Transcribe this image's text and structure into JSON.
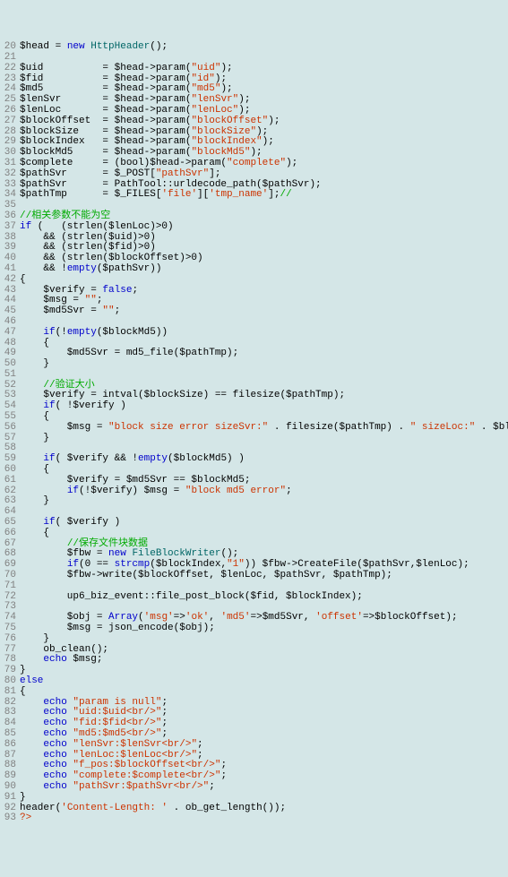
{
  "lines": [
    {
      "n": 20,
      "segs": [
        [
          "",
          "$head = "
        ],
        [
          "kw",
          "new"
        ],
        [
          "",
          " "
        ],
        [
          "cls",
          "HttpHeader"
        ],
        [
          "",
          "();"
        ]
      ]
    },
    {
      "n": 21,
      "segs": [
        [
          "",
          ""
        ]
      ]
    },
    {
      "n": 22,
      "segs": [
        [
          "",
          "$uid          = $head->param("
        ],
        [
          "str",
          "\"uid\""
        ],
        [
          "",
          ");"
        ]
      ]
    },
    {
      "n": 23,
      "segs": [
        [
          "",
          "$fid          = $head->param("
        ],
        [
          "str",
          "\"id\""
        ],
        [
          "",
          ");"
        ]
      ]
    },
    {
      "n": 24,
      "segs": [
        [
          "",
          "$md5          = $head->param("
        ],
        [
          "str",
          "\"md5\""
        ],
        [
          "",
          ");"
        ]
      ]
    },
    {
      "n": 25,
      "segs": [
        [
          "",
          "$lenSvr       = $head->param("
        ],
        [
          "str",
          "\"lenSvr\""
        ],
        [
          "",
          ");"
        ]
      ]
    },
    {
      "n": 26,
      "segs": [
        [
          "",
          "$lenLoc       = $head->param("
        ],
        [
          "str",
          "\"lenLoc\""
        ],
        [
          "",
          ");"
        ]
      ]
    },
    {
      "n": 27,
      "segs": [
        [
          "",
          "$blockOffset  = $head->param("
        ],
        [
          "str",
          "\"blockOffset\""
        ],
        [
          "",
          ");"
        ]
      ]
    },
    {
      "n": 28,
      "segs": [
        [
          "",
          "$blockSize    = $head->param("
        ],
        [
          "str",
          "\"blockSize\""
        ],
        [
          "",
          ");"
        ]
      ]
    },
    {
      "n": 29,
      "segs": [
        [
          "",
          "$blockIndex   = $head->param("
        ],
        [
          "str",
          "\"blockIndex\""
        ],
        [
          "",
          ");"
        ]
      ]
    },
    {
      "n": 30,
      "segs": [
        [
          "",
          "$blockMd5     = $head->param("
        ],
        [
          "str",
          "\"blockMd5\""
        ],
        [
          "",
          ");"
        ]
      ]
    },
    {
      "n": 31,
      "segs": [
        [
          "",
          "$complete     = (bool)$head->param("
        ],
        [
          "str",
          "\"complete\""
        ],
        [
          "",
          ");"
        ]
      ]
    },
    {
      "n": 32,
      "segs": [
        [
          "",
          "$pathSvr      = $_POST["
        ],
        [
          "str",
          "\"pathSvr\""
        ],
        [
          "",
          "];"
        ]
      ]
    },
    {
      "n": 33,
      "segs": [
        [
          "",
          "$pathSvr      = PathTool::urldecode_path($pathSvr);"
        ]
      ]
    },
    {
      "n": 34,
      "segs": [
        [
          "",
          "$pathTmp      = $_FILES["
        ],
        [
          "str",
          "'file'"
        ],
        [
          "",
          "]["
        ],
        [
          "str",
          "'tmp_name'"
        ],
        [
          "",
          "];"
        ],
        [
          "cmt",
          "//"
        ]
      ]
    },
    {
      "n": 35,
      "segs": [
        [
          "",
          ""
        ]
      ]
    },
    {
      "n": 36,
      "segs": [
        [
          "cmt",
          "//相关参数不能为空"
        ]
      ]
    },
    {
      "n": 37,
      "segs": [
        [
          "kw",
          "if"
        ],
        [
          "",
          " (   (strlen($lenLoc)>0)"
        ]
      ]
    },
    {
      "n": 38,
      "segs": [
        [
          "",
          "    && (strlen($uid)>0)"
        ]
      ]
    },
    {
      "n": 39,
      "segs": [
        [
          "",
          "    && (strlen($fid)>0)"
        ]
      ]
    },
    {
      "n": 40,
      "segs": [
        [
          "",
          "    && (strlen($blockOffset)>0)"
        ]
      ]
    },
    {
      "n": 41,
      "segs": [
        [
          "",
          "    && !"
        ],
        [
          "kw",
          "empty"
        ],
        [
          "",
          "($pathSvr))"
        ]
      ]
    },
    {
      "n": 42,
      "segs": [
        [
          "",
          "{"
        ]
      ]
    },
    {
      "n": 43,
      "segs": [
        [
          "",
          "    $verify = "
        ],
        [
          "kw",
          "false"
        ],
        [
          "",
          ";"
        ]
      ]
    },
    {
      "n": 44,
      "segs": [
        [
          "",
          "    $msg = "
        ],
        [
          "str",
          "\"\""
        ],
        [
          "",
          ";"
        ]
      ]
    },
    {
      "n": 45,
      "segs": [
        [
          "",
          "    $md5Svr = "
        ],
        [
          "str",
          "\"\""
        ],
        [
          "",
          ";"
        ]
      ]
    },
    {
      "n": 46,
      "segs": [
        [
          "",
          ""
        ]
      ]
    },
    {
      "n": 47,
      "segs": [
        [
          "",
          "    "
        ],
        [
          "kw",
          "if"
        ],
        [
          "",
          "(!"
        ],
        [
          "kw",
          "empty"
        ],
        [
          "",
          "($blockMd5))"
        ]
      ]
    },
    {
      "n": 48,
      "segs": [
        [
          "",
          "    {"
        ]
      ]
    },
    {
      "n": 49,
      "segs": [
        [
          "",
          "        $md5Svr = md5_file($pathTmp);"
        ]
      ]
    },
    {
      "n": 50,
      "segs": [
        [
          "",
          "    }"
        ]
      ]
    },
    {
      "n": 51,
      "segs": [
        [
          "",
          ""
        ]
      ]
    },
    {
      "n": 52,
      "segs": [
        [
          "",
          "    "
        ],
        [
          "cmt",
          "//验证大小"
        ]
      ]
    },
    {
      "n": 53,
      "segs": [
        [
          "",
          "    $verify = intval($blockSize) == filesize($pathTmp);"
        ]
      ]
    },
    {
      "n": 54,
      "segs": [
        [
          "",
          "    "
        ],
        [
          "kw",
          "if"
        ],
        [
          "",
          "( !$verify )"
        ]
      ]
    },
    {
      "n": 55,
      "segs": [
        [
          "",
          "    {"
        ]
      ]
    },
    {
      "n": 56,
      "segs": [
        [
          "",
          "        $msg = "
        ],
        [
          "str",
          "\"block size error sizeSvr:\""
        ],
        [
          "",
          " . filesize($pathTmp) . "
        ],
        [
          "str",
          "\" sizeLoc:\""
        ],
        [
          "",
          " . $blockSize;"
        ]
      ]
    },
    {
      "n": 57,
      "segs": [
        [
          "",
          "    }"
        ]
      ]
    },
    {
      "n": 58,
      "segs": [
        [
          "",
          ""
        ]
      ]
    },
    {
      "n": 59,
      "segs": [
        [
          "",
          "    "
        ],
        [
          "kw",
          "if"
        ],
        [
          "",
          "( $verify && !"
        ],
        [
          "kw",
          "empty"
        ],
        [
          "",
          "($blockMd5) )"
        ]
      ]
    },
    {
      "n": 60,
      "segs": [
        [
          "",
          "    {"
        ]
      ]
    },
    {
      "n": 61,
      "segs": [
        [
          "",
          "        $verify = $md5Svr == $blockMd5;"
        ]
      ]
    },
    {
      "n": 62,
      "segs": [
        [
          "",
          "        "
        ],
        [
          "kw",
          "if"
        ],
        [
          "",
          "(!$verify) $msg = "
        ],
        [
          "str",
          "\"block md5 error\""
        ],
        [
          "",
          ";"
        ]
      ]
    },
    {
      "n": 63,
      "segs": [
        [
          "",
          "    }"
        ]
      ]
    },
    {
      "n": 64,
      "segs": [
        [
          "",
          ""
        ]
      ]
    },
    {
      "n": 65,
      "segs": [
        [
          "",
          "    "
        ],
        [
          "kw",
          "if"
        ],
        [
          "",
          "( $verify )"
        ]
      ]
    },
    {
      "n": 66,
      "segs": [
        [
          "",
          "    {"
        ]
      ]
    },
    {
      "n": 67,
      "segs": [
        [
          "",
          "        "
        ],
        [
          "cmt",
          "//保存文件块数据"
        ]
      ]
    },
    {
      "n": 68,
      "segs": [
        [
          "",
          "        $fbw = "
        ],
        [
          "kw",
          "new"
        ],
        [
          "",
          " "
        ],
        [
          "cls",
          "FileBlockWriter"
        ],
        [
          "",
          "();"
        ]
      ]
    },
    {
      "n": 69,
      "segs": [
        [
          "",
          "        "
        ],
        [
          "kw",
          "if"
        ],
        [
          "",
          "(0 == "
        ],
        [
          "kw",
          "strcmp"
        ],
        [
          "",
          "($blockIndex,"
        ],
        [
          "str",
          "\"1\""
        ],
        [
          "",
          ")) $fbw->CreateFile($pathSvr,$lenLoc);"
        ]
      ]
    },
    {
      "n": 70,
      "segs": [
        [
          "",
          "        $fbw->write($blockOffset, $lenLoc, $pathSvr, $pathTmp);"
        ]
      ]
    },
    {
      "n": 71,
      "segs": [
        [
          "",
          ""
        ]
      ]
    },
    {
      "n": 72,
      "segs": [
        [
          "",
          "        up6_biz_event::file_post_block($fid, $blockIndex);"
        ]
      ]
    },
    {
      "n": 73,
      "segs": [
        [
          "",
          ""
        ]
      ]
    },
    {
      "n": 74,
      "segs": [
        [
          "",
          "        $obj = "
        ],
        [
          "kw",
          "Array"
        ],
        [
          "",
          "("
        ],
        [
          "str",
          "'msg'"
        ],
        [
          "",
          "=>"
        ],
        [
          "str",
          "'ok'"
        ],
        [
          "",
          ", "
        ],
        [
          "str",
          "'md5'"
        ],
        [
          "",
          "=>$md5Svr, "
        ],
        [
          "str",
          "'offset'"
        ],
        [
          "",
          "=>$blockOffset);"
        ]
      ]
    },
    {
      "n": 75,
      "segs": [
        [
          "",
          "        $msg = json_encode($obj);"
        ]
      ]
    },
    {
      "n": 76,
      "segs": [
        [
          "",
          "    }"
        ]
      ]
    },
    {
      "n": 77,
      "segs": [
        [
          "",
          "    ob_clean();"
        ]
      ]
    },
    {
      "n": 78,
      "segs": [
        [
          "",
          "    "
        ],
        [
          "kw",
          "echo"
        ],
        [
          "",
          " $msg;"
        ]
      ]
    },
    {
      "n": 79,
      "segs": [
        [
          "",
          "}"
        ]
      ]
    },
    {
      "n": 80,
      "segs": [
        [
          "kw",
          "else"
        ]
      ]
    },
    {
      "n": 81,
      "segs": [
        [
          "",
          "{"
        ]
      ]
    },
    {
      "n": 82,
      "segs": [
        [
          "",
          "    "
        ],
        [
          "kw",
          "echo"
        ],
        [
          "",
          " "
        ],
        [
          "str",
          "\"param is null\""
        ],
        [
          "",
          ";"
        ]
      ]
    },
    {
      "n": 83,
      "segs": [
        [
          "",
          "    "
        ],
        [
          "kw",
          "echo"
        ],
        [
          "",
          " "
        ],
        [
          "str",
          "\"uid:$uid<br/>\""
        ],
        [
          "",
          ";"
        ]
      ]
    },
    {
      "n": 84,
      "segs": [
        [
          "",
          "    "
        ],
        [
          "kw",
          "echo"
        ],
        [
          "",
          " "
        ],
        [
          "str",
          "\"fid:$fid<br/>\""
        ],
        [
          "",
          ";"
        ]
      ]
    },
    {
      "n": 85,
      "segs": [
        [
          "",
          "    "
        ],
        [
          "kw",
          "echo"
        ],
        [
          "",
          " "
        ],
        [
          "str",
          "\"md5:$md5<br/>\""
        ],
        [
          "",
          ";"
        ]
      ]
    },
    {
      "n": 86,
      "segs": [
        [
          "",
          "    "
        ],
        [
          "kw",
          "echo"
        ],
        [
          "",
          " "
        ],
        [
          "str",
          "\"lenSvr:$lenSvr<br/>\""
        ],
        [
          "",
          ";"
        ]
      ]
    },
    {
      "n": 87,
      "segs": [
        [
          "",
          "    "
        ],
        [
          "kw",
          "echo"
        ],
        [
          "",
          " "
        ],
        [
          "str",
          "\"lenLoc:$lenLoc<br/>\""
        ],
        [
          "",
          ";"
        ]
      ]
    },
    {
      "n": 88,
      "segs": [
        [
          "",
          "    "
        ],
        [
          "kw",
          "echo"
        ],
        [
          "",
          " "
        ],
        [
          "str",
          "\"f_pos:$blockOffset<br/>\""
        ],
        [
          "",
          ";"
        ]
      ]
    },
    {
      "n": 89,
      "segs": [
        [
          "",
          "    "
        ],
        [
          "kw",
          "echo"
        ],
        [
          "",
          " "
        ],
        [
          "str",
          "\"complete:$complete<br/>\""
        ],
        [
          "",
          ";"
        ]
      ]
    },
    {
      "n": 90,
      "segs": [
        [
          "",
          "    "
        ],
        [
          "kw",
          "echo"
        ],
        [
          "",
          " "
        ],
        [
          "str",
          "\"pathSvr:$pathSvr<br/>\""
        ],
        [
          "",
          ";"
        ]
      ]
    },
    {
      "n": 91,
      "segs": [
        [
          "",
          "}"
        ]
      ]
    },
    {
      "n": 92,
      "segs": [
        [
          "",
          "header("
        ],
        [
          "str",
          "'Content-Length: '"
        ],
        [
          "",
          " . ob_get_length());"
        ]
      ]
    },
    {
      "n": 93,
      "segs": [
        [
          "str",
          "?>"
        ]
      ]
    }
  ]
}
